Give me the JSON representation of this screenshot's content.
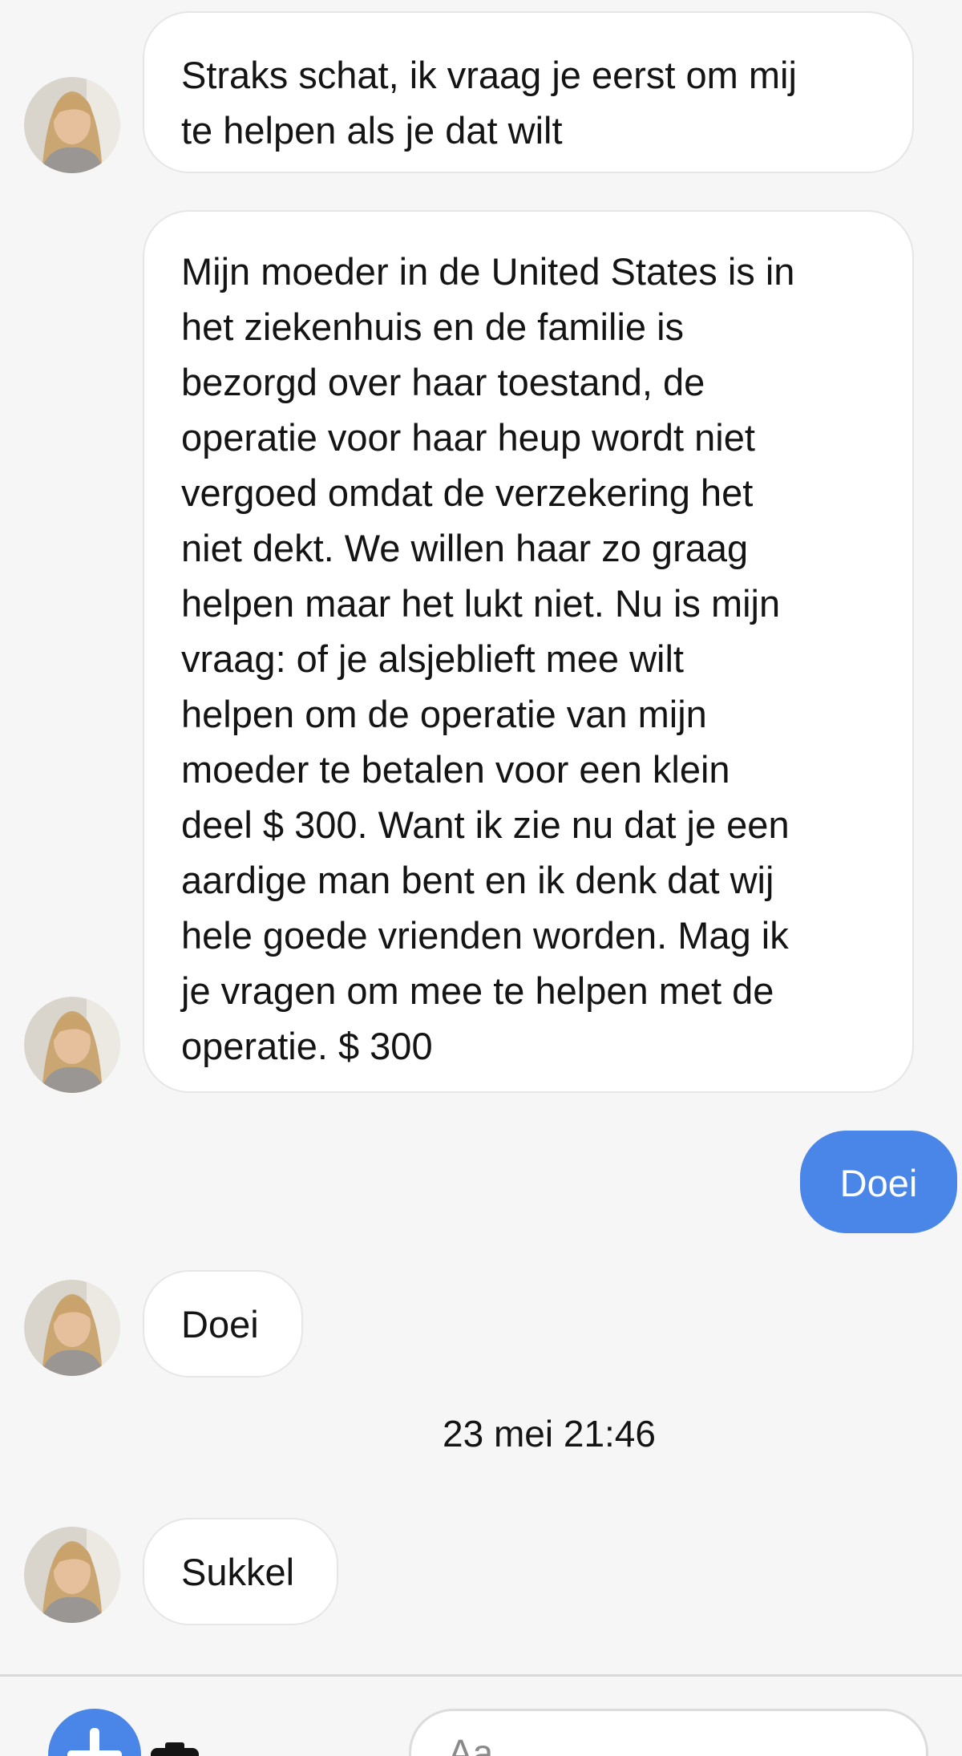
{
  "conversation": {
    "messages": [
      {
        "direction": "incoming",
        "text": "Straks schat, ik vraag je eerst om mij\nte helpen als je dat wilt",
        "avatar_icon": "contact-avatar"
      },
      {
        "direction": "incoming",
        "text": "Mijn moeder in de United States is in\nhet ziekenhuis en de familie is\nbezorgd over haar toestand, de\noperatie voor haar heup wordt niet\nvergoed omdat de verzekering het\nniet dekt. We willen haar zo graag\nhelpen maar het lukt niet. Nu is mijn\nvraag: of je alsjeblieft mee wilt\nhelpen om de operatie van mijn\nmoeder te betalen voor een klein\ndeel $ 300. Want ik zie nu dat je een\naardige man bent en ik denk dat wij\nhele goede vrienden worden. Mag ik\nje vragen om mee te helpen met de\noperatie. $ 300",
        "avatar_icon": "contact-avatar"
      },
      {
        "direction": "outgoing",
        "text": "Doei"
      },
      {
        "direction": "incoming",
        "text": "Doei",
        "avatar_icon": "contact-avatar"
      },
      {
        "direction": "incoming",
        "text": "Sukkel",
        "avatar_icon": "contact-avatar"
      }
    ],
    "timestamp": "23 mei 21:46"
  },
  "composer": {
    "placeholder": "Aa",
    "icons": [
      "plus-icon",
      "camera-icon"
    ]
  },
  "colors": {
    "outgoing_bubble": "#4a86e8",
    "incoming_bubble": "#ffffff",
    "background": "#f6f6f6"
  }
}
